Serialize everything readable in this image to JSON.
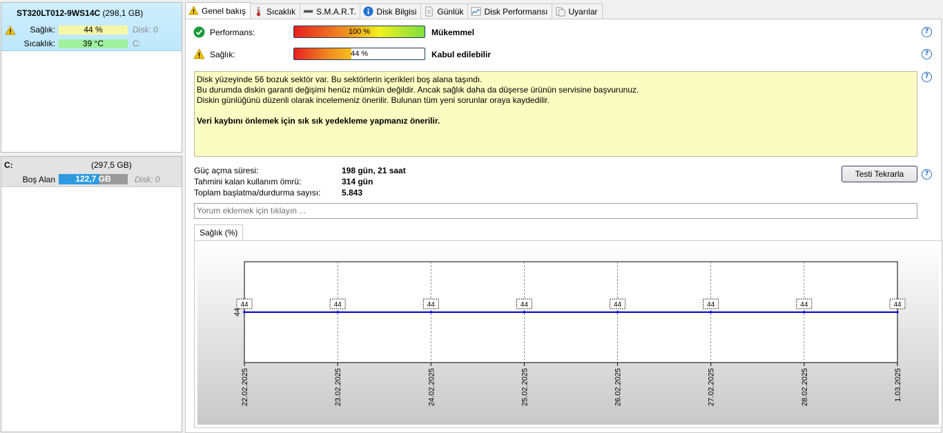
{
  "disk": {
    "name": "ST320LT012-9WS14C",
    "size": "(298,1 GB)",
    "health_label": "Sağlık:",
    "health_value": "44 %",
    "temp_label": "Sıcaklık:",
    "temp_value": "39 °C",
    "disk_index": "Disk: 0",
    "drive_letter": "C:"
  },
  "volume": {
    "letter": "C:",
    "size": "(297,5 GB)",
    "free_label": "Boş Alan",
    "free_value": "122,7 GB",
    "disk_index": "Disk: 0",
    "used_fraction": 0.59
  },
  "tabs": [
    {
      "label": "Genel bakış",
      "icon": "warning-icon"
    },
    {
      "label": "Sıcaklık",
      "icon": "thermometer-icon"
    },
    {
      "label": "S.M.A.R.T.",
      "icon": "smart-icon"
    },
    {
      "label": "Disk Bilgisi",
      "icon": "info-icon"
    },
    {
      "label": "Günlük",
      "icon": "document-icon"
    },
    {
      "label": "Disk Performansı",
      "icon": "chart-icon"
    },
    {
      "label": "Uyarılar",
      "icon": "alerts-icon"
    }
  ],
  "performance": {
    "label": "Performans:",
    "value": "100 %",
    "percent": 100,
    "verdict": "Mükemmel"
  },
  "health": {
    "label": "Sağlık:",
    "value": "44 %",
    "percent": 44,
    "verdict": "Kabul edilebilir"
  },
  "message": {
    "line1": "Disk yüzeyinde 56 bozuk sektör var. Bu sektörlerin içerikleri boş alana taşındı.",
    "line2": "Bu durumda diskin garanti değişimi henüz mümkün değildir. Ancak sağlık daha da düşerse ürünün servisine başvurunuz.",
    "line3": "Diskin günlüğünü düzenli olarak incelemeniz önerilir. Bulunan tüm yeni sorunlar oraya kaydedilir.",
    "bold": "Veri kaybını önlemek için sık sık yedekleme yapmanız önerilir."
  },
  "info": {
    "power_on_label": "Güç açma süresi:",
    "power_on_value": "198 gün, 21 saat",
    "remaining_label": "Tahmini kalan kullanım ömrü:",
    "remaining_value": "314 gün",
    "startstop_label": "Toplam başlatma/durdurma sayısı:",
    "startstop_value": "5.843"
  },
  "retest_button": "Testi Tekrarla",
  "comment_placeholder": "Yorum eklemek için tıklayın ...",
  "chart_tab": "Sağlık (%)",
  "chart_data": {
    "type": "line",
    "x": [
      "22.02.2025",
      "23.02.2025",
      "24.02.2025",
      "25.02.2025",
      "26.02.2025",
      "27.02.2025",
      "28.02.2025",
      "1.03.2025"
    ],
    "series": [
      {
        "values": [
          44,
          44,
          44,
          44,
          44,
          44,
          44,
          44
        ]
      }
    ],
    "ytick": "44",
    "color": "#0000d0"
  }
}
